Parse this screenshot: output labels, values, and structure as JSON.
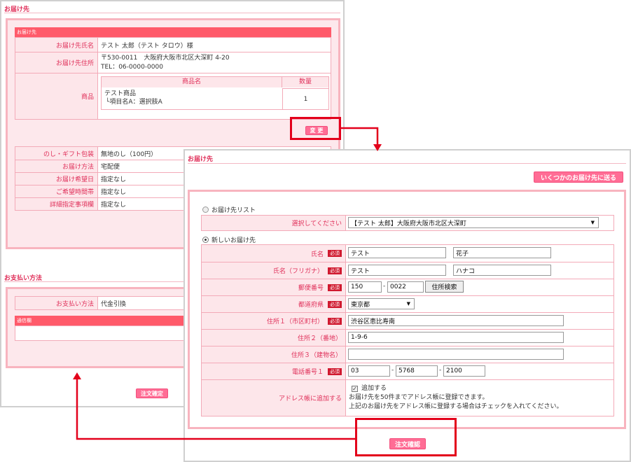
{
  "back": {
    "title": "お届け先",
    "box_header": "お届け先",
    "name_label": "お届け先氏名",
    "name_value": "テスト 太郎（テスト タロウ）様",
    "address_label": "お届け先住所",
    "address_line1": "〒530-0011　大阪府大阪市北区大深町 4-20",
    "address_line2": "TEL：06-0000-0000",
    "product_label": "商品",
    "product_col_name": "商品名",
    "product_col_qty": "数量",
    "product_name": "テスト商品",
    "product_option": "└項目名A：選択肢A",
    "product_qty": "1",
    "change_button": "変 更",
    "info_rows": [
      {
        "label": "のし・ギフト包装",
        "value": "無地のし（100円）"
      },
      {
        "label": "お届け方法",
        "value": "宅配便"
      },
      {
        "label": "お届け希望日",
        "value": "指定なし"
      },
      {
        "label": "ご希望時間帯",
        "value": "指定なし"
      },
      {
        "label": "詳細指定事項欄",
        "value": "指定なし"
      }
    ],
    "payment_title": "お支払い方法",
    "payment_label": "お支払い方法",
    "payment_value": "代金引換",
    "comm_header": "通信欄",
    "confirm_button": "注文確定"
  },
  "front": {
    "title": "お届け先",
    "multi_button": "いくつかのお届け先に送る",
    "option_list": "お届け先リスト",
    "select_label": "選択してください",
    "select_value": "【テスト 太郎】大阪府大阪市北区大深町",
    "option_new": "新しいお届け先",
    "required_badge": "必須",
    "fields": {
      "name_label": "氏名",
      "name_last": "テスト",
      "name_first": "花子",
      "kana_label": "氏名（フリガナ）",
      "kana_last": "テスト",
      "kana_first": "ハナコ",
      "zip_label": "郵便番号",
      "zip1": "150",
      "zip2": "0022",
      "zip_search": "住所検索",
      "pref_label": "都道府県",
      "pref_value": "東京都",
      "addr1_label": "住所１（市区町村）",
      "addr1_value": "渋谷区恵比寿南",
      "addr2_label": "住所２（番地）",
      "addr2_value": "1-9-6",
      "addr3_label": "住所３（建物名）",
      "addr3_value": "",
      "tel_label": "電話番号１",
      "tel1": "03",
      "tel2": "5768",
      "tel3": "2100",
      "book_label": "アドレス帳に追加する",
      "book_check": "追加する",
      "book_note1": "お届け先を50件までアドレス帳に登録できます。",
      "book_note2": "上記のお届け先をアドレス帳に登録する場合はチェックを入れてください。"
    },
    "confirm_button": "注文確認"
  },
  "colors": {
    "accent": "#e0305a",
    "header": "#ff5a6a",
    "frame": "#e3001b",
    "button": "#ff6d95"
  }
}
